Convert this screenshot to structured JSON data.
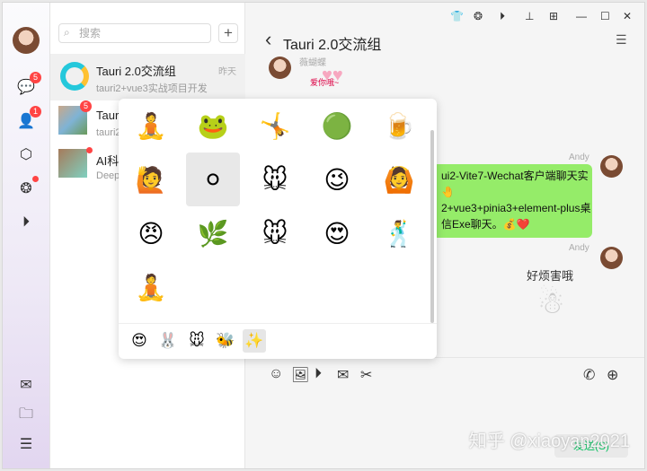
{
  "sidebar": {
    "chat_badge": "5",
    "contacts_badge": "1"
  },
  "list": {
    "search_placeholder": "搜索",
    "add": "+",
    "items": [
      {
        "title": "Tauri 2.0交流组",
        "subtitle": "tauri2+vue3实战项目开发",
        "time": "昨天"
      },
      {
        "title": "Taur",
        "subtitle": "tauri2",
        "badge": "5"
      },
      {
        "title": "AI科",
        "subtitle": "Deep"
      }
    ]
  },
  "chat": {
    "title": "Tauri 2.0交流组",
    "back": "‹",
    "sender1": "薇蝴蝶",
    "sender2": "Andy",
    "sender3": "Andy",
    "message": [
      "ui2-Vite7-Wechat客户端聊天实",
      "🤚",
      "2+vue3+pinia3+element-plus桌",
      "信Exe聊天。💰❤️"
    ],
    "sticker1_caption": "爱你哦~",
    "sticker2_caption": "好烦害哦"
  },
  "stickers": [
    "🧘",
    "🐸",
    "🤸",
    "🟢",
    "🍺",
    "🙋",
    "⚪",
    "🐭",
    "😉",
    "🙆",
    "😠",
    "🌿",
    "🐭",
    "😍",
    "🕺",
    "🧘"
  ],
  "sticker_tabs": [
    "😍",
    "🐰",
    "🐭",
    "🐝",
    "✨"
  ],
  "input": {
    "send": "发送(S)"
  },
  "watermark": "知乎 @xiaoyan2021"
}
